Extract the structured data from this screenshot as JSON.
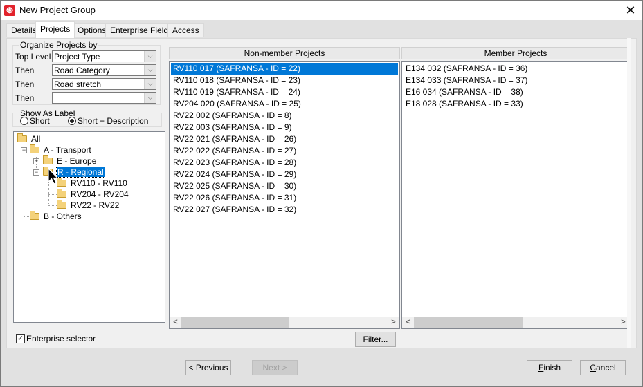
{
  "window": {
    "title": "New Project Group",
    "app_icon": "app-logo-icon",
    "close_icon": "close-icon",
    "close_glyph": "✕"
  },
  "tabs": [
    {
      "label": "Details",
      "active": false
    },
    {
      "label": "Projects",
      "active": true
    },
    {
      "label": "Options",
      "active": false
    },
    {
      "label": "Enterprise Fields",
      "active": false
    },
    {
      "label": "Access",
      "active": false
    }
  ],
  "organize": {
    "legend": "Organize Projects by",
    "rows": [
      {
        "label": "Top Level",
        "value": "Project Type"
      },
      {
        "label": "Then",
        "value": "Road Category"
      },
      {
        "label": "Then",
        "value": "Road stretch"
      },
      {
        "label": "Then",
        "value": ""
      }
    ],
    "dropdown_glyph": "⌵"
  },
  "show_as_label": {
    "legend": "Show As Label",
    "options": [
      {
        "label": "Short",
        "selected": false
      },
      {
        "label": "Short + Description",
        "selected": true
      }
    ]
  },
  "tree": {
    "items": [
      {
        "label": "All",
        "level": 0,
        "expander": "",
        "selected": false
      },
      {
        "label": "A - Transport",
        "level": 1,
        "expander": "−",
        "selected": false
      },
      {
        "label": "E - Europe",
        "level": 2,
        "expander": "+",
        "selected": false
      },
      {
        "label": "R - Regional",
        "level": 2,
        "expander": "−",
        "selected": true
      },
      {
        "label": "RV110 - RV110",
        "level": 3,
        "expander": "",
        "selected": false
      },
      {
        "label": "RV204 - RV204",
        "level": 3,
        "expander": "",
        "selected": false
      },
      {
        "label": "RV22 - RV22",
        "level": 3,
        "expander": "",
        "selected": false
      },
      {
        "label": "B - Others",
        "level": 1,
        "expander": "",
        "selected": false
      }
    ]
  },
  "non_member": {
    "header": "Non-member Projects",
    "items": [
      "RV110 017 (SAFRANSA - ID = 22)",
      "RV110 018 (SAFRANSA - ID = 23)",
      "RV110 019 (SAFRANSA - ID = 24)",
      "RV204 020 (SAFRANSA - ID = 25)",
      "RV22 002 (SAFRANSA - ID = 8)",
      "RV22 003 (SAFRANSA - ID = 9)",
      "RV22 021 (SAFRANSA - ID = 26)",
      "RV22 022 (SAFRANSA - ID = 27)",
      "RV22 023 (SAFRANSA - ID = 28)",
      "RV22 024 (SAFRANSA - ID = 29)",
      "RV22 025 (SAFRANSA - ID = 30)",
      "RV22 026 (SAFRANSA - ID = 31)",
      "RV22 027 (SAFRANSA - ID = 32)"
    ],
    "selected_index": 0
  },
  "member": {
    "header": "Member Projects",
    "items": [
      "E134 032 (SAFRANSA - ID = 36)",
      "E134 033 (SAFRANSA - ID = 37)",
      "E16 034 (SAFRANSA - ID = 38)",
      "E18 028 (SAFRANSA - ID = 33)"
    ]
  },
  "scroll": {
    "left_glyph": "<",
    "right_glyph": ">"
  },
  "enterprise_selector": {
    "label": "Enterprise selector",
    "checked": true,
    "check_glyph": "✓"
  },
  "filter_button": "Filter...",
  "footer": {
    "previous": "< Previous",
    "next": "Next >",
    "finish": "Finish",
    "cancel": "Cancel"
  }
}
